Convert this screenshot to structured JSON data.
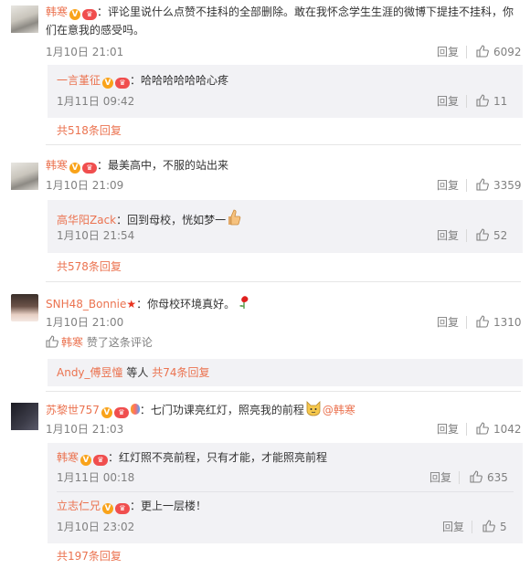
{
  "c1": {
    "user": "韩寒",
    "text_line1": "：评论里说什么点赞不挂科的全部删除。敢在我怀念学生生涯的微博下提挂不挂科，你",
    "text_line2": "们在意我的感受吗。",
    "time": "1月10日 21:01",
    "reply_label": "回复",
    "likes": "6092",
    "sub": {
      "user": "一言堇征",
      "text": "哈哈哈哈哈哈心疼",
      "time": "1月11日 09:42",
      "reply_label": "回复",
      "likes": "11"
    },
    "more": "共518条回复"
  },
  "c2": {
    "user": "韩寒",
    "text": "：最美高中，不服的站出来",
    "time": "1月10日 21:09",
    "reply_label": "回复",
    "likes": "3359",
    "sub": {
      "user": "高华阳Zack",
      "text": "：回到母校，恍如梦一",
      "time": "1月10日 21:54",
      "reply_label": "回复",
      "likes": "52"
    },
    "more": "共578条回复"
  },
  "c3": {
    "user": "SNH48_Bonnie",
    "text": "：你母校环境真好。",
    "time": "1月10日 21:00",
    "reply_label": "回复",
    "likes": "1310",
    "liked_by": "韩寒",
    "liked_suffix": "赞了这条评论",
    "sub_summary_user": "Andy_傅昱憧",
    "sub_summary_mid": "等人",
    "sub_summary_more": "共74条回复"
  },
  "c4": {
    "user": "苏黎世757",
    "text": "：七门功课亮红灯，照亮我的前程",
    "mention": "@韩寒",
    "time": "1月10日 21:03",
    "reply_label": "回复",
    "likes": "1042",
    "subs": [
      {
        "user": "韩寒",
        "text": "：红灯照不亮前程，只有才能，才能照亮前程",
        "time": "1月11日 00:18",
        "reply_label": "回复",
        "likes": "635"
      },
      {
        "user": "立志仁兄",
        "text": "：更上一层楼！",
        "time": "1月10日 23:02",
        "reply_label": "回复",
        "likes": "5"
      }
    ],
    "more": "共197条回复"
  },
  "colors": {
    "username": "#eb7350",
    "meta": "#808080",
    "sub_bg": "#f2f2f5"
  },
  "icons": [
    "thumb-up-icon",
    "verified-v-icon",
    "vip-badge-icon",
    "star-icon",
    "rose-emoji",
    "thumbs-up-emoji",
    "dog-emoji",
    "balloon-badge-icon"
  ]
}
